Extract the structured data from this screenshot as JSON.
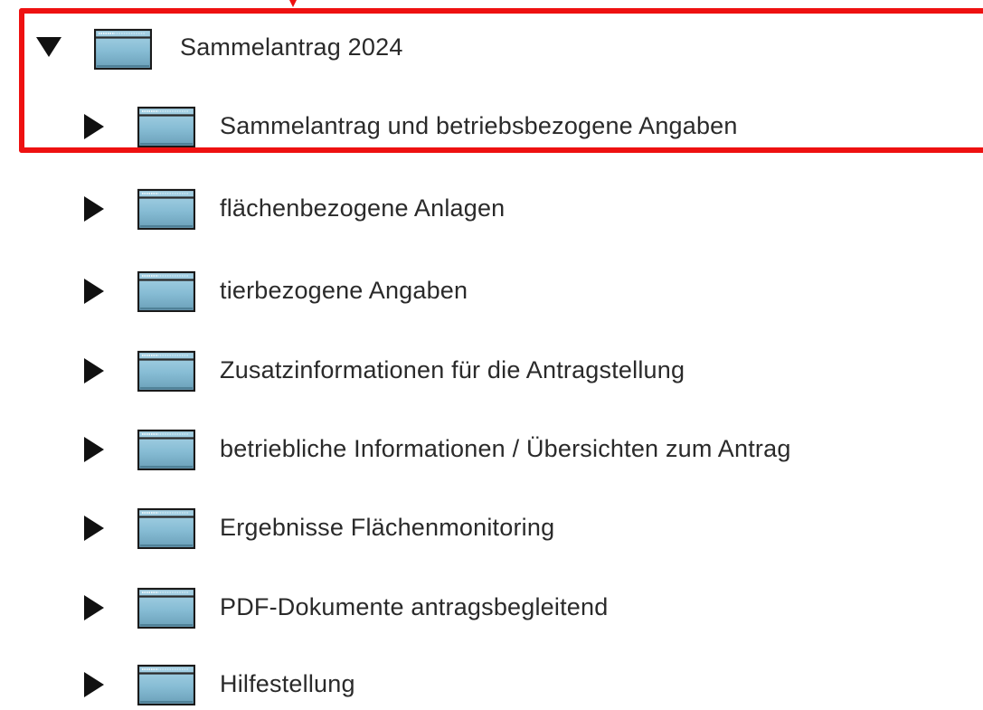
{
  "accent_color": "#ee1111",
  "folder_icon": "folder-icon",
  "tree": {
    "root": {
      "label": "Sammelantrag 2024",
      "state": "expanded"
    },
    "children": [
      {
        "label": "Sammelantrag und betriebsbezogene Angaben",
        "state": "collapsed"
      },
      {
        "label": "flächenbezogene Anlagen",
        "state": "collapsed"
      },
      {
        "label": "tierbezogene Angaben",
        "state": "collapsed"
      },
      {
        "label": "Zusatzinformationen für die Antragstellung",
        "state": "collapsed"
      },
      {
        "label": "betriebliche Informationen / Übersichten zum Antrag",
        "state": "collapsed"
      },
      {
        "label": "Ergebnisse Flächenmonitoring",
        "state": "collapsed"
      },
      {
        "label": "PDF-Dokumente antragsbegleitend",
        "state": "collapsed"
      },
      {
        "label": "Hilfestellung",
        "state": "collapsed"
      }
    ]
  }
}
